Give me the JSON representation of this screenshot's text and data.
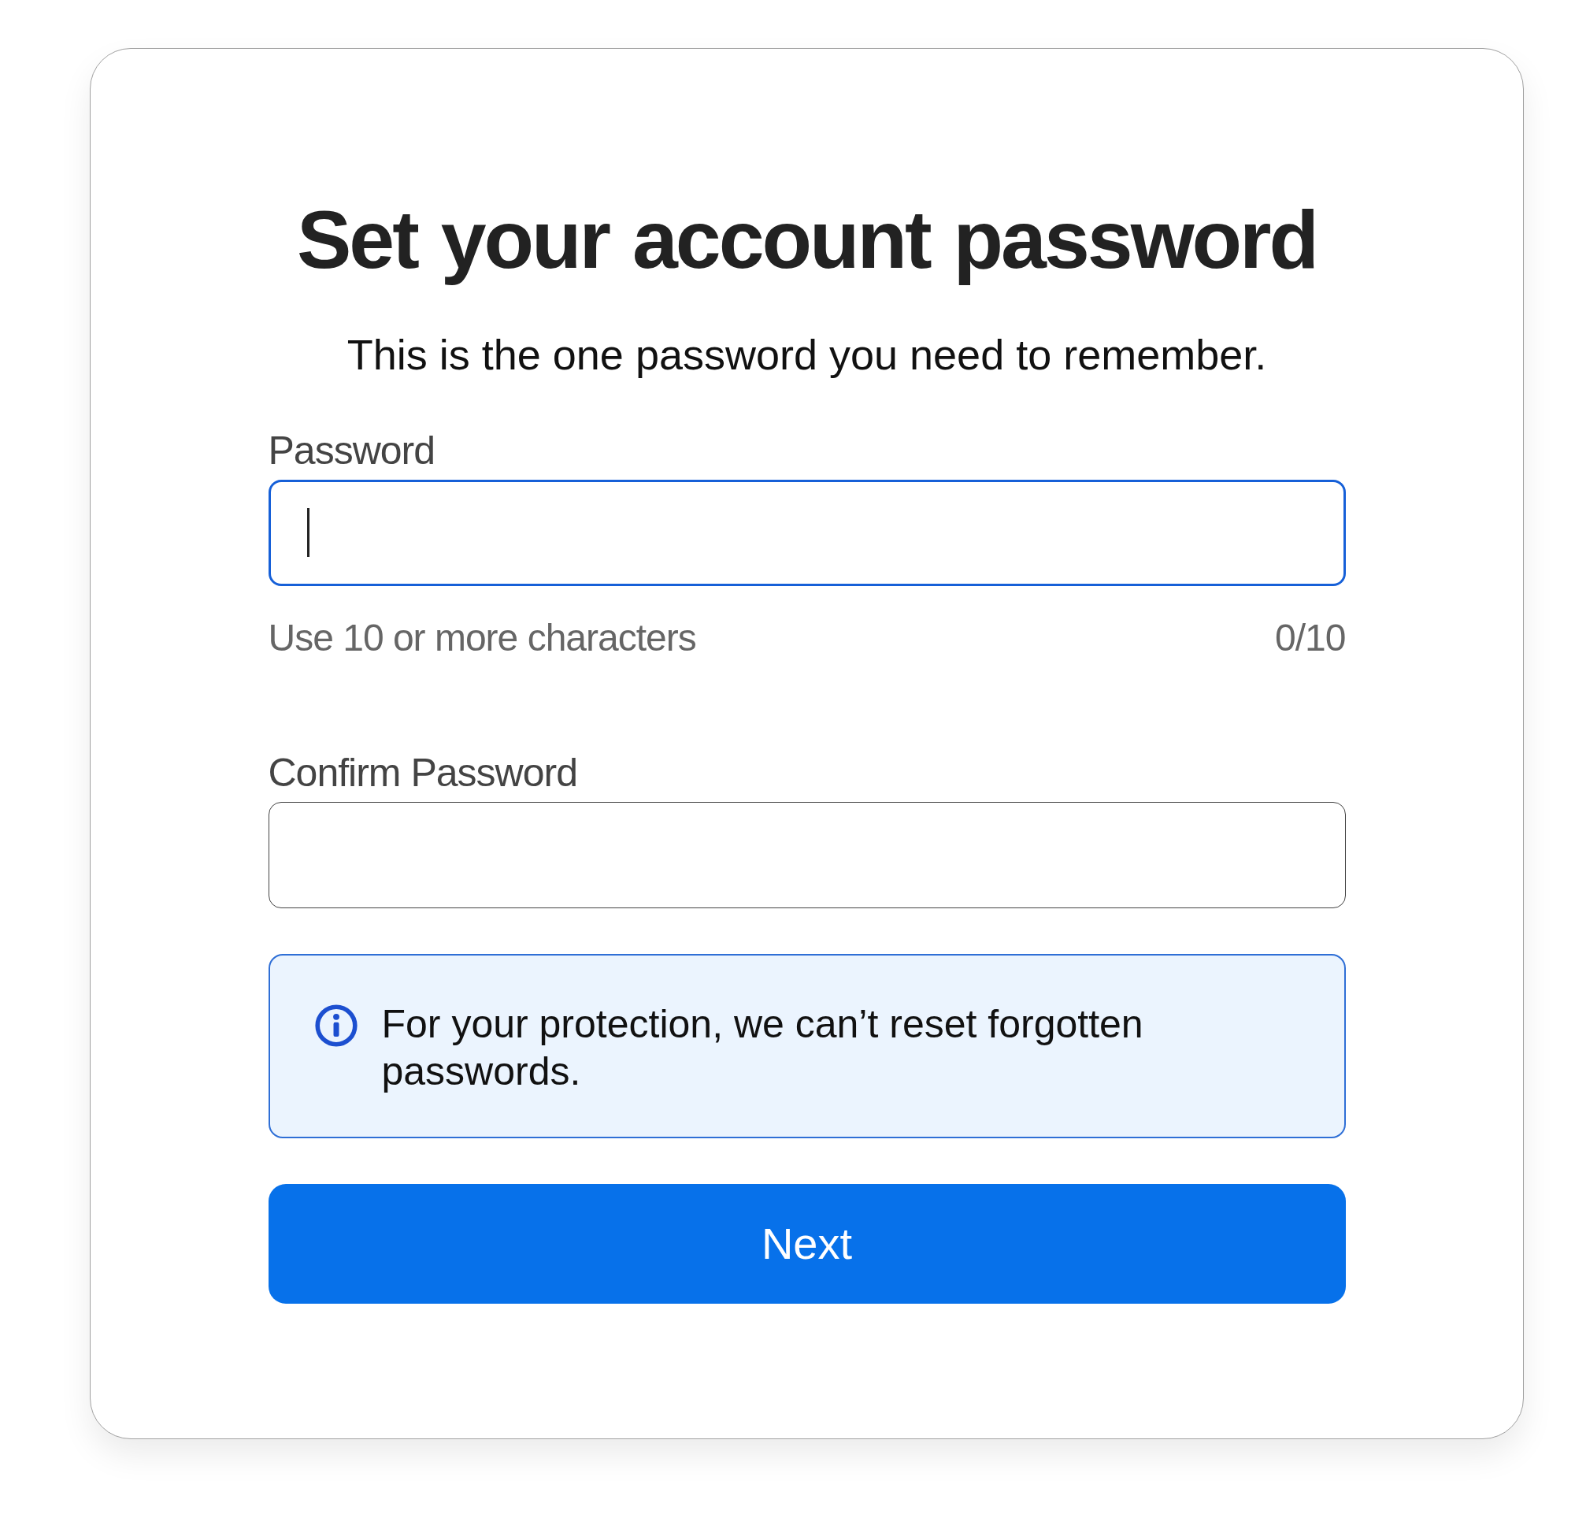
{
  "title": "Set your account password",
  "subtitle": "This is the one password you need to remember.",
  "fields": [
    {
      "label": "Password",
      "focused": true,
      "hint": "Use 10 or more characters",
      "counter": "0/10"
    },
    {
      "label": "Confirm Password",
      "focused": false
    }
  ],
  "notice": {
    "text": "For your protection, we can’t reset forgotten passwords."
  },
  "button": "Next"
}
